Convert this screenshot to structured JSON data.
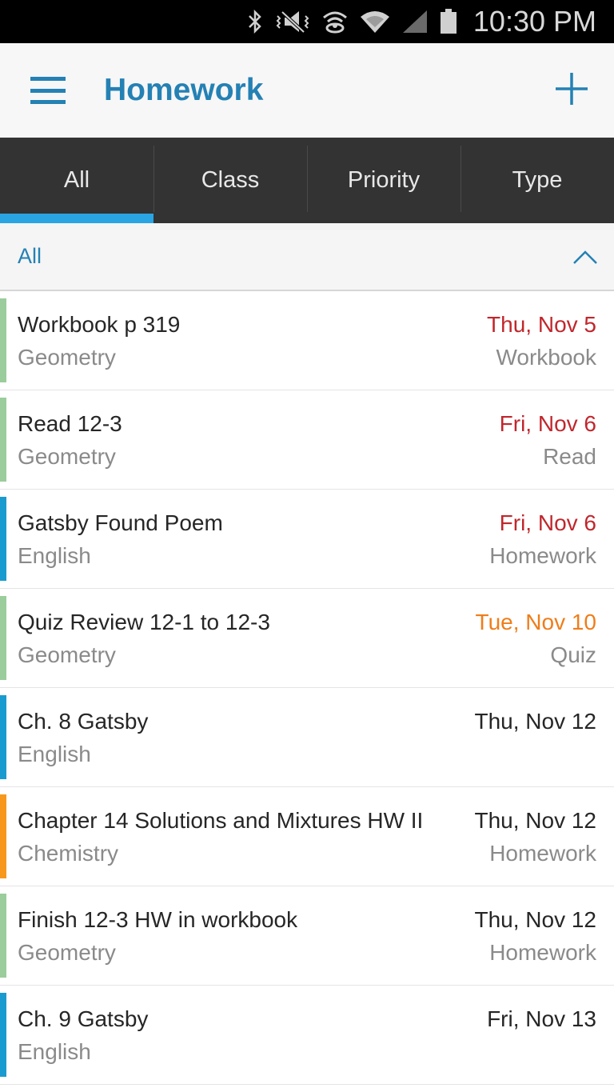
{
  "status_bar": {
    "time": "10:30 PM",
    "icons": [
      "bluetooth-icon",
      "vibrate-mute-icon",
      "hotspot-icon",
      "wifi-icon",
      "signal-icon",
      "battery-icon"
    ]
  },
  "app_bar": {
    "title": "Homework",
    "menu_icon": "hamburger-icon",
    "add_icon": "plus-icon"
  },
  "tabs": [
    {
      "label": "All",
      "active": true
    },
    {
      "label": "Class",
      "active": false
    },
    {
      "label": "Priority",
      "active": false
    },
    {
      "label": "Type",
      "active": false
    }
  ],
  "filter": {
    "label": "All",
    "icon": "chevron-up-icon"
  },
  "colors": {
    "accent": "#2481b4",
    "tab_indicator": "#2aa5e4",
    "overdue": "#c0272d",
    "upcoming": "#ef7d1a",
    "normal": "#262626",
    "geometry": "#9acd9b",
    "english": "#1a9bd0",
    "chemistry": "#f7981d"
  },
  "assignments": [
    {
      "title": "Workbook p 319",
      "class": "Geometry",
      "due": "Thu, Nov 5",
      "type": "Workbook",
      "class_color": "#9acd9b",
      "due_color": "#c0272d"
    },
    {
      "title": "Read 12-3",
      "class": "Geometry",
      "due": "Fri, Nov 6",
      "type": "Read",
      "class_color": "#9acd9b",
      "due_color": "#c0272d"
    },
    {
      "title": "Gatsby Found Poem",
      "class": "English",
      "due": "Fri, Nov 6",
      "type": "Homework",
      "class_color": "#1a9bd0",
      "due_color": "#c0272d"
    },
    {
      "title": "Quiz Review 12-1 to 12-3",
      "class": "Geometry",
      "due": "Tue, Nov 10",
      "type": "Quiz",
      "class_color": "#9acd9b",
      "due_color": "#ef7d1a"
    },
    {
      "title": "Ch. 8 Gatsby",
      "class": "English",
      "due": "Thu, Nov 12",
      "type": "",
      "class_color": "#1a9bd0",
      "due_color": "#262626"
    },
    {
      "title": "Chapter 14 Solutions and Mixtures HW II",
      "class": "Chemistry",
      "due": "Thu, Nov 12",
      "type": "Homework",
      "class_color": "#f7981d",
      "due_color": "#262626"
    },
    {
      "title": "Finish 12-3 HW in workbook",
      "class": "Geometry",
      "due": "Thu, Nov 12",
      "type": "Homework",
      "class_color": "#9acd9b",
      "due_color": "#262626"
    },
    {
      "title": "Ch. 9 Gatsby",
      "class": "English",
      "due": "Fri, Nov 13",
      "type": "",
      "class_color": "#1a9bd0",
      "due_color": "#262626"
    }
  ]
}
